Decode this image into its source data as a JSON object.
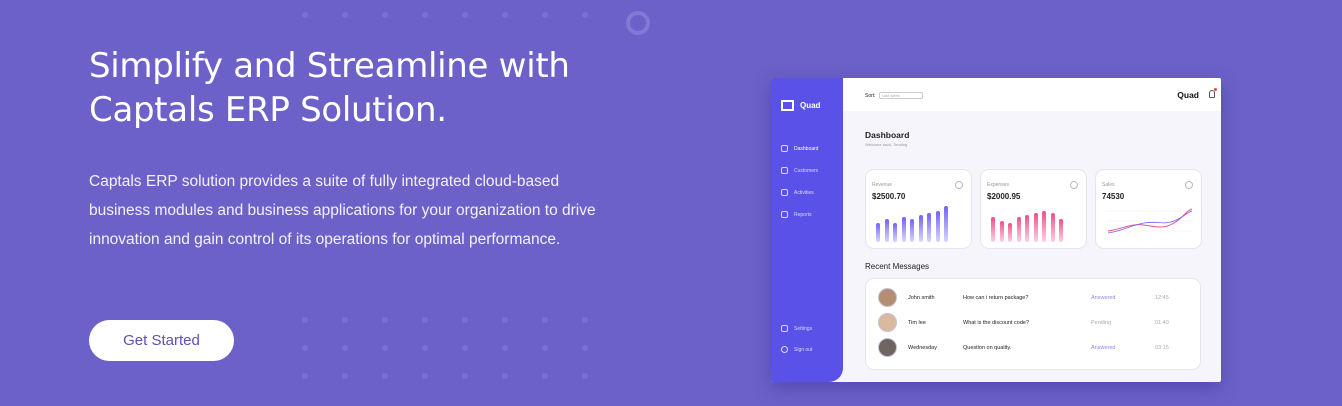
{
  "hero": {
    "title": "Simplify and Streamline with Captals ERP Solution.",
    "description": "Captals ERP solution provides a suite of fully integrated cloud-based business modules and business applications for your organization to drive innovation and gain control of its operations for optimal performance.",
    "cta_label": "Get Started"
  },
  "colors": {
    "background": "#6c61c8",
    "sidebar": "#5a51e8",
    "revenue_bar": "#6f63f5",
    "expenses_bar": "#ec4f8b",
    "answered": "#8f87e8"
  },
  "dashboard": {
    "brand": "Quad",
    "top_brand": "Quad",
    "sort_label": "Sort:",
    "sort_value": "Last week",
    "title": "Dashboard",
    "subtitle": "Welcome back, Tending",
    "nav": [
      {
        "label": "Dashboard",
        "icon": "home-icon"
      },
      {
        "label": "Customers",
        "icon": "users-icon"
      },
      {
        "label": "Activities",
        "icon": "activity-icon"
      },
      {
        "label": "Reports",
        "icon": "report-icon"
      },
      {
        "label": "Settings",
        "icon": "gear-icon"
      },
      {
        "label": "Sign out",
        "icon": "signout-icon"
      }
    ],
    "cards": [
      {
        "label": "Revenue",
        "value": "$2500.70",
        "bars": [
          0.45,
          0.55,
          0.45,
          0.6,
          0.55,
          0.65,
          0.7,
          0.75,
          0.85
        ]
      },
      {
        "label": "Expenses",
        "value": "$2000.95",
        "bars": [
          0.6,
          0.5,
          0.45,
          0.6,
          0.65,
          0.7,
          0.75,
          0.7,
          0.55
        ]
      },
      {
        "label": "Sales",
        "value": "74530"
      }
    ],
    "recent_title": "Recent Messages",
    "messages": [
      {
        "name": "John smith",
        "text": "How can i return package?",
        "status": "Answered",
        "time": "12:45"
      },
      {
        "name": "Tim lee",
        "text": "What is the discount code?",
        "status": "Pending",
        "time": "01:40"
      },
      {
        "name": "Wednesday",
        "text": "Question on quality.",
        "status": "Answered",
        "time": "03:15"
      }
    ]
  }
}
